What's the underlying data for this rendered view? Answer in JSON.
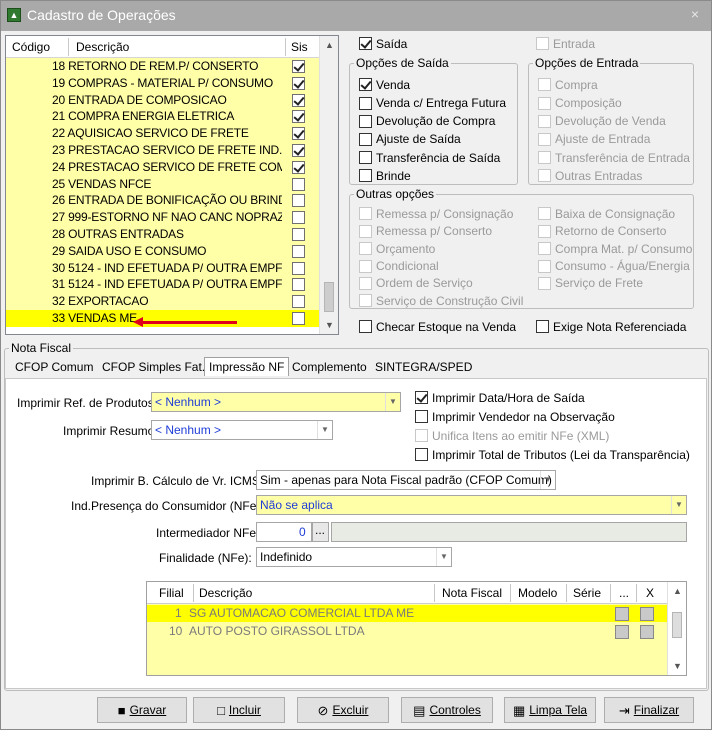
{
  "window": {
    "title": "Cadastro de Operações",
    "close": "×"
  },
  "list": {
    "col_codigo": "Código",
    "col_descricao": "Descrição",
    "col_sis": "Sis",
    "rows": [
      {
        "text": "18 RETORNO DE REM.P/ CONSERTO",
        "sis": true
      },
      {
        "text": "19 COMPRAS - MATERIAL P/ CONSUMO",
        "sis": true
      },
      {
        "text": "20 ENTRADA DE COMPOSICAO",
        "sis": true
      },
      {
        "text": "21 COMPRA ENERGIA ELETRICA",
        "sis": true
      },
      {
        "text": "22 AQUISICAO SERVICO DE FRETE",
        "sis": true
      },
      {
        "text": "23 PRESTACAO SERVICO DE FRETE IND.",
        "sis": true
      },
      {
        "text": "24 PRESTACAO SERVICO DE FRETE COM",
        "sis": true
      },
      {
        "text": "25 VENDAS NFCE",
        "sis": false
      },
      {
        "text": "26 ENTRADA DE BONIFICAÇÃO OU BRIND",
        "sis": false
      },
      {
        "text": "27 999-ESTORNO NF NAO CANC NOPRAZ",
        "sis": false
      },
      {
        "text": "28 OUTRAS ENTRADAS",
        "sis": false
      },
      {
        "text": "29 SAIDA USO E CONSUMO",
        "sis": false
      },
      {
        "text": "30 5124 - IND EFETUADA P/ OUTRA EMPF",
        "sis": false
      },
      {
        "text": "31 5124 - IND EFETUADA P/ OUTRA EMPF",
        "sis": false
      },
      {
        "text": "32 EXPORTACAO",
        "sis": false
      },
      {
        "text": "33 VENDAS ME",
        "sis": false
      }
    ]
  },
  "tipo": {
    "saida": "Saída",
    "entrada": "Entrada"
  },
  "opcoes_saida": {
    "legend": "Opções de Saída",
    "items": [
      "Venda",
      "Venda c/ Entrega Futura",
      "Devolução de Compra",
      "Ajuste de Saída",
      "Transferência de Saída",
      "Brinde"
    ]
  },
  "opcoes_entrada": {
    "legend": "Opções de Entrada",
    "items": [
      "Compra",
      "Composição",
      "Devolução de Venda",
      "Ajuste de Entrada",
      "Transferência de Entrada",
      "Outras Entradas"
    ]
  },
  "outras": {
    "legend": "Outras opções",
    "left": [
      "Remessa p/ Consignação",
      "Remessa p/ Conserto",
      "Orçamento",
      "Condicional",
      "Ordem de Serviço",
      "Serviço de Construção Civil"
    ],
    "right": [
      "Baixa de Consignação",
      "Retorno de Conserto",
      "Compra Mat. p/ Consumo",
      "Consumo - Água/Energia",
      "Serviço de Frete"
    ]
  },
  "checks": {
    "estoque": "Checar Estoque na Venda",
    "nota_ref": "Exige Nota Referenciada"
  },
  "nota_fiscal": {
    "legend": "Nota Fiscal",
    "tabs": [
      "CFOP Comum",
      "CFOP Simples Fat.",
      "Impressão NF",
      "Complemento",
      "SINTEGRA/SPED"
    ]
  },
  "impressao": {
    "ref_produtos_label": "Imprimir Ref. de Produtos:",
    "ref_produtos_value": "< Nenhum >",
    "resumo_label": "Imprimir Resumo:",
    "resumo_value": "< Nenhum >",
    "data_hora": "Imprimir Data/Hora de Saída",
    "vendedor": "Imprimir Vendedor na Observação",
    "unifica": "Unifica Itens ao emitir NFe (XML)",
    "tributos": "Imprimir Total de Tributos (Lei da Transparência)",
    "calculo_label": "Imprimir B. Cálculo de Vr. ICMS:",
    "calculo_value": "Sim - apenas para Nota Fiscal padrão (CFOP Comum)",
    "presenca_label": "Ind.Presença do Consumidor (NFe):",
    "presenca_value": "Não se aplica",
    "intermediador_label": "Intermediador NFe:",
    "intermediador_value": "0",
    "dots": "...",
    "finalidade_label": "Finalidade (NFe):",
    "finalidade_value": "Indefinido"
  },
  "grid": {
    "headers": [
      "Filial",
      "Descrição",
      "Nota Fiscal",
      "Modelo",
      "Série",
      "...",
      "X"
    ],
    "rows": [
      {
        "filial": "1",
        "descricao": "SG AUTOMACAO COMERCIAL LTDA ME"
      },
      {
        "filial": "10",
        "descricao": "AUTO POSTO GIRASSOL LTDA"
      }
    ]
  },
  "buttons": [
    "Gravar",
    "Incluir",
    "Excluir",
    "Controles",
    "Limpa Tela",
    "Finalizar"
  ]
}
